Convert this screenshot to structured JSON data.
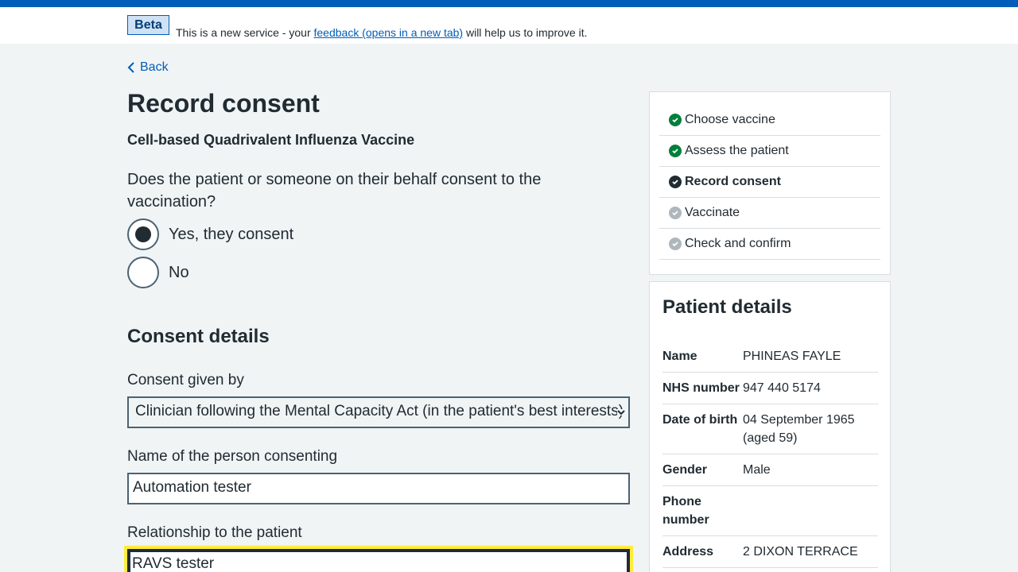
{
  "phase": {
    "tag": "Beta",
    "text_before": "This is a new service - your",
    "link": "feedback (opens in a new tab)",
    "text_after": "will help us to improve it."
  },
  "nav": {
    "back_label": "Back"
  },
  "page": {
    "title": "Record consent",
    "vaccine": "Cell-based Quadrivalent Influenza Vaccine",
    "question": "Does the patient or someone on their behalf consent to the vaccination?"
  },
  "consent_options": [
    {
      "label": "Yes, they consent",
      "selected": true
    },
    {
      "label": "No",
      "selected": false
    }
  ],
  "consent_details": {
    "heading": "Consent details",
    "given_by_label": "Consent given by",
    "given_by_value": "Clinician following the Mental Capacity Act (in the patient's best interests)",
    "name_label": "Name of the person consenting",
    "name_value": "Automation tester",
    "relationship_label": "Relationship to the patient",
    "relationship_value": "RAVS tester"
  },
  "steps": [
    {
      "label": "Choose vaccine",
      "status": "complete"
    },
    {
      "label": "Assess the patient",
      "status": "complete"
    },
    {
      "label": "Record consent",
      "status": "current"
    },
    {
      "label": "Vaccinate",
      "status": "pending"
    },
    {
      "label": "Check and confirm",
      "status": "pending"
    }
  ],
  "patient": {
    "heading": "Patient details",
    "rows": [
      {
        "key": "Name",
        "value": "PHINEAS FAYLE"
      },
      {
        "key": "NHS number",
        "value": "947 440 5174"
      },
      {
        "key": "Date of birth",
        "value": "04 September 1965 (aged 59)"
      },
      {
        "key": "Gender",
        "value": "Male"
      },
      {
        "key": "Phone number",
        "value": ""
      },
      {
        "key": "Address",
        "value": "2 DIXON TERRACE"
      }
    ]
  },
  "colors": {
    "brand": "#005eb8",
    "complete": "#007f3b",
    "current": "#212b32",
    "pending": "#aeb7bd",
    "focus": "#ffeb3b"
  }
}
